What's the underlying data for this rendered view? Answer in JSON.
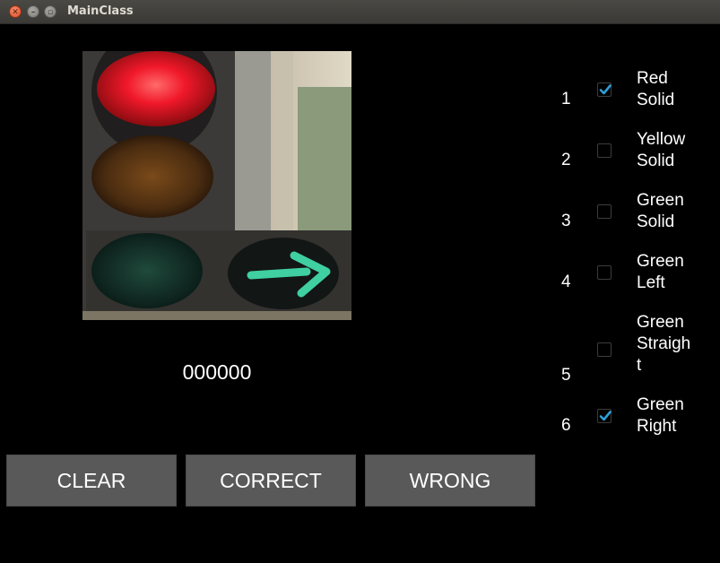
{
  "window": {
    "title": "MainClass"
  },
  "counter": "000000",
  "buttons": {
    "clear": "CLEAR",
    "correct": "CORRECT",
    "wrong": "WRONG"
  },
  "options": [
    {
      "num": "1",
      "line1": "Red",
      "line2": "Solid",
      "line3": "",
      "checked": true
    },
    {
      "num": "2",
      "line1": "Yellow",
      "line2": "Solid",
      "line3": "",
      "checked": false
    },
    {
      "num": "3",
      "line1": "Green",
      "line2": "Solid",
      "line3": "",
      "checked": false
    },
    {
      "num": "4",
      "line1": "Green",
      "line2": "Left",
      "line3": "",
      "checked": false
    },
    {
      "num": "5",
      "line1": "Green",
      "line2": "Straigh",
      "line3": "t",
      "checked": false
    },
    {
      "num": "6",
      "line1": "Green",
      "line2": "Right",
      "line3": "",
      "checked": true
    }
  ],
  "colors": {
    "accent": "#2f9fd8",
    "button": "#595959",
    "background": "#000000"
  },
  "icons": {
    "close": "close-icon",
    "minimize": "minimize-icon",
    "maximize": "maximize-icon",
    "check": "check-icon"
  }
}
